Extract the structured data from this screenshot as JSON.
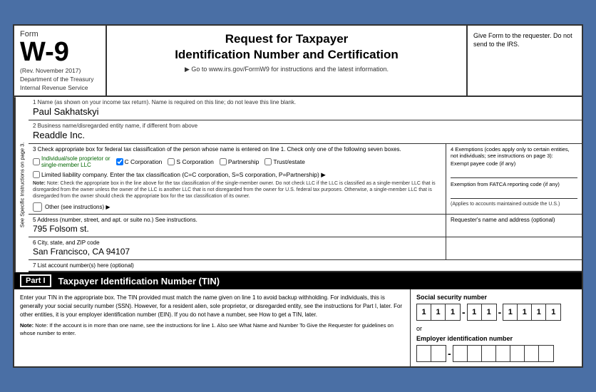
{
  "header": {
    "form_label": "Form",
    "form_number": "W-9",
    "rev_date": "(Rev. November 2017)",
    "department": "Department of the Treasury",
    "irs": "Internal Revenue Service",
    "title_line1": "Request for Taxpayer",
    "title_line2": "Identification Number and Certification",
    "go_to": "▶ Go to www.irs.gov/FormW9 for instructions and the latest information.",
    "right_text": "Give Form to the requester. Do not send to the IRS."
  },
  "side_label": "See Specific Instructions on page 3.",
  "fields": {
    "line1_label": "1  Name (as shown on your income tax return). Name is required on this line; do not leave this line blank.",
    "line1_value": "Paul Sakhatskyi",
    "line2_label": "2  Business name/disregarded entity name, if different from above",
    "line2_value": "Readdle Inc.",
    "line3_label": "3  Check appropriate box for federal tax classification of the person whose name is entered on line 1. Check only one of the following seven boxes.",
    "exemptions_label": "4  Exemptions (codes apply only to certain entities, not individuals; see instructions on page 3):",
    "exempt_payee_label": "Exempt payee code (if any)",
    "exempt_fatca_label": "Exemption from FATCA reporting code (if any)",
    "fatca_note": "(Applies to accounts maintained outside the U.S.)",
    "checkboxes": {
      "individual": "Individual/sole proprietor or single-member LLC",
      "c_corp": "C Corporation",
      "s_corp": "S Corporation",
      "partnership": "Partnership",
      "trust": "Trust/estate"
    },
    "c_corp_checked": true,
    "llc_label": "Limited liability company. Enter the tax classification (C=C corporation, S=S corporation, P=Partnership) ▶",
    "llc_note": "Note: Check the appropriate box in the line above for the tax classification of the single-member owner. Do not check LLC if the LLC is classified as a single-member LLC that is disregarded from the owner unless the owner of the LLC is another LLC that is not disregarded from the owner for U.S. federal tax purposes. Otherwise, a single-member LLC that is disregarded from the owner should check the appropriate box for the tax classification of its owner.",
    "other_label": "Other (see instructions) ▶",
    "line5_label": "5  Address (number, street, and apt. or suite no.) See instructions.",
    "line5_value": "795 Folsom st.",
    "requesters_label": "Requester's name and address (optional)",
    "line6_label": "6  City, state, and ZIP code",
    "line6_value": "San Francisco, CA 94107",
    "line7_label": "7  List account number(s) here (optional)"
  },
  "part1": {
    "badge": "Part I",
    "title": "Taxpayer Identification Number (TIN)",
    "body_text": "Enter your TIN in the appropriate box. The TIN provided must match the name given on line 1 to avoid backup withholding. For individuals, this is generally your social security number (SSN). However, for a resident alien, sole proprietor, or disregarded entity, see the instructions for Part I, later. For other entities, it is your employer identification number (EIN). If you do not have a number, see How to get a TIN, later.",
    "note_text": "Note: If the account is in more than one name, see the instructions for line 1. Also see What Name and Number To Give the Requester for guidelines on whose number to enter.",
    "ssn_label": "Social security number",
    "ssn": [
      "1",
      "1",
      "1",
      "1",
      "1",
      "1",
      "1",
      "1",
      "1"
    ],
    "ssn_groups": [
      [
        "1",
        "1",
        "1"
      ],
      [
        "1",
        "1"
      ],
      [
        "1",
        "1",
        "1",
        "1"
      ]
    ],
    "or_text": "or",
    "ein_label": "Employer identification number",
    "ein_groups": [
      [
        "",
        ""
      ],
      [
        "",
        "",
        "",
        "",
        "",
        "",
        ""
      ]
    ],
    "ein_dash": "-"
  }
}
